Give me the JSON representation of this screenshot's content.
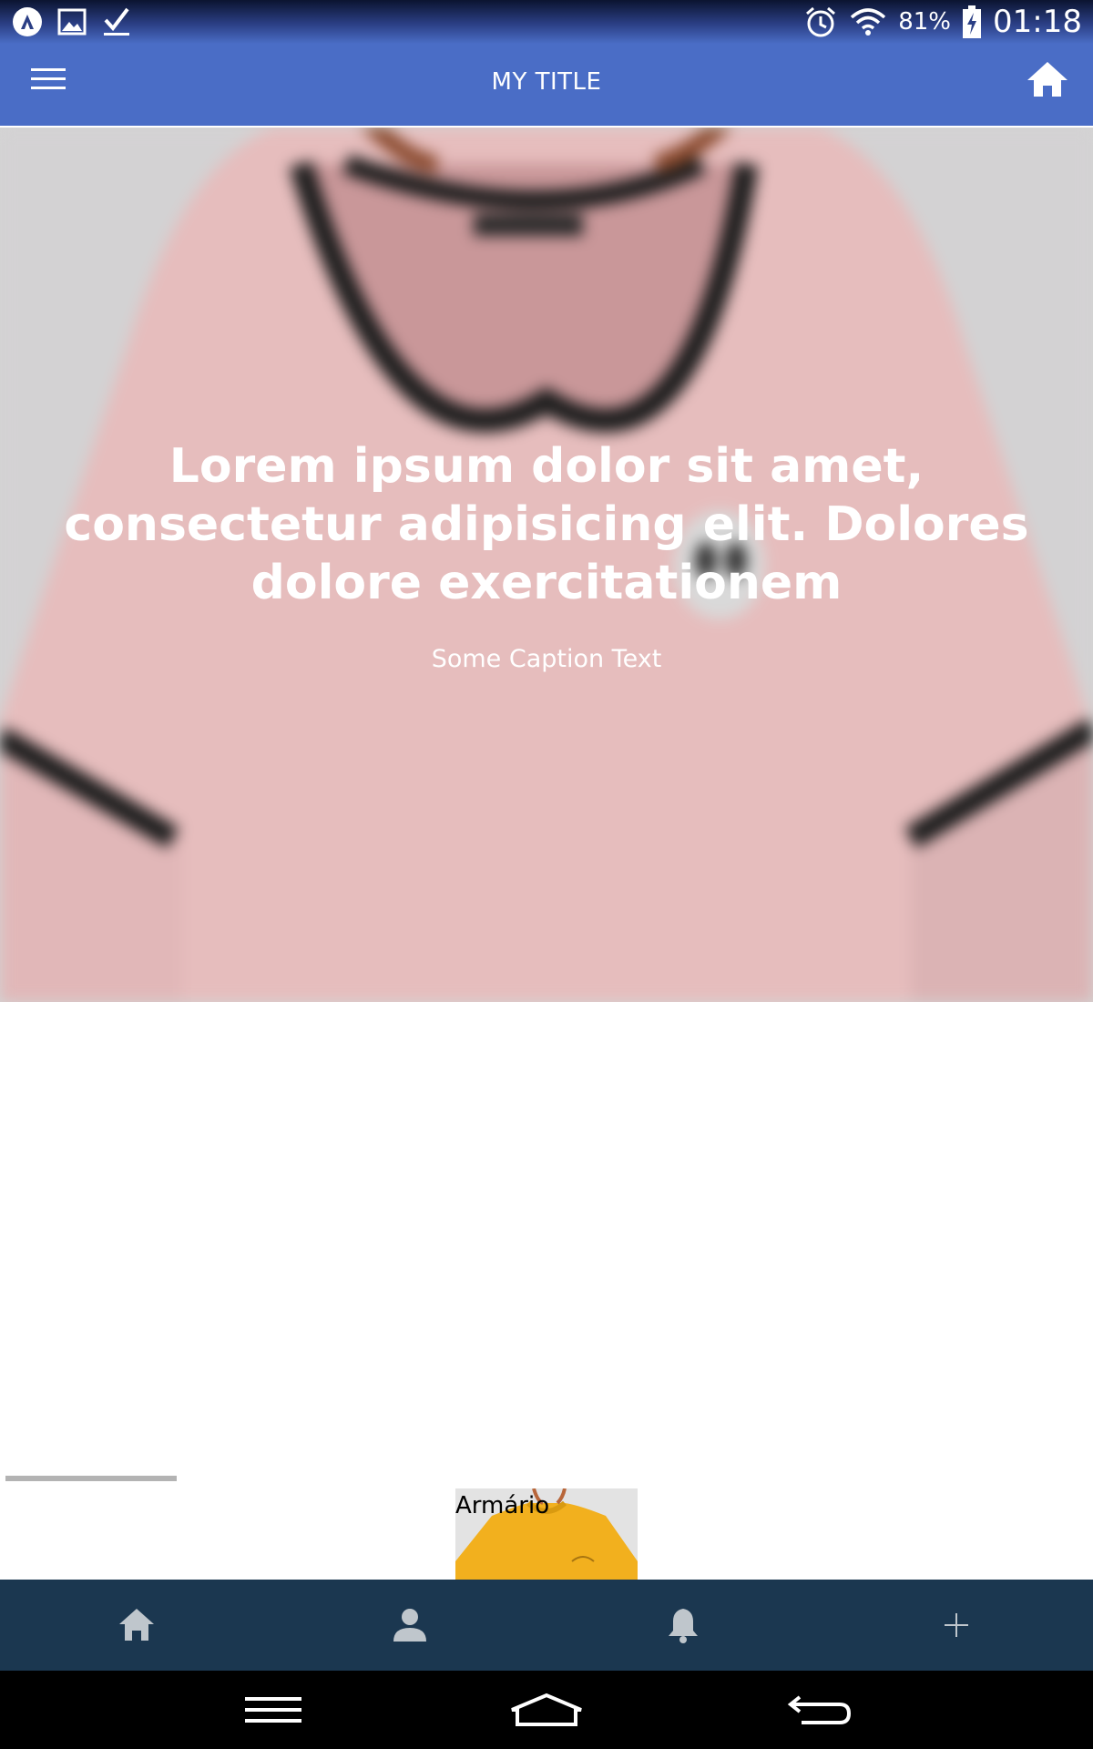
{
  "status_bar": {
    "battery": "81%",
    "time": "01:18"
  },
  "app_bar": {
    "title": "MY TITLE"
  },
  "hero": {
    "heading": "Lorem ipsum dolor sit amet, consectetur adipisicing elit. Dolores dolore exercitationem",
    "caption": "Some Caption Text"
  },
  "card": {
    "label": "Armário"
  },
  "bottom_nav": {
    "items": [
      "home-icon",
      "person-icon",
      "bell-icon",
      "plus-icon"
    ]
  },
  "colors": {
    "app_bar": "#4a6dc6",
    "bottom_nav": "#1b3750",
    "system_nav": "#000000"
  }
}
